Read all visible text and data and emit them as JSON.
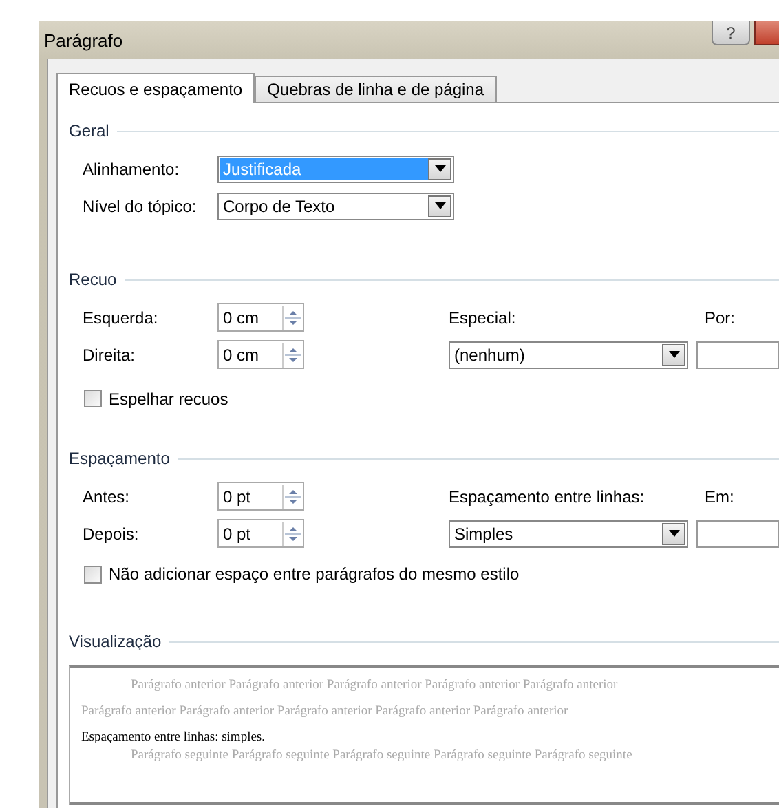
{
  "window": {
    "title": "Parágrafo",
    "help_button": "?"
  },
  "tabs": [
    {
      "label": "Recuos e espaçamento",
      "selected": true
    },
    {
      "label": "Quebras de linha e de página",
      "selected": false
    }
  ],
  "general": {
    "heading": "Geral",
    "fields": [
      {
        "label": "Alinhamento:",
        "value": "Justificada",
        "focused": true
      },
      {
        "label": "Nível do tópico:",
        "value": "Corpo de Texto",
        "focused": false
      }
    ]
  },
  "indent": {
    "heading": "Recuo",
    "spinners": [
      {
        "label": "Esquerda:",
        "value": "0 cm"
      },
      {
        "label": "Direita:",
        "value": "0 cm"
      }
    ],
    "special_label": "Especial:",
    "special_value": "(nenhum)",
    "by_label": "Por:",
    "checkbox": {
      "label": "Espelhar recuos",
      "checked": false
    }
  },
  "spacing": {
    "heading": "Espaçamento",
    "spinners": [
      {
        "label": "Antes:",
        "value": "0 pt"
      },
      {
        "label": "Depois:",
        "value": "0 pt"
      }
    ],
    "line_label": "Espaçamento entre linhas:",
    "line_value": "Simples",
    "at_label": "Em:",
    "checkbox": {
      "label": "Não adicionar espaço entre parágrafos do mesmo estilo",
      "checked": false
    }
  },
  "preview": {
    "heading": "Visualização",
    "before": [
      "Parágrafo anterior Parágrafo anterior Parágrafo anterior Parágrafo anterior Parágrafo anterior",
      "Parágrafo anterior Parágrafo anterior Parágrafo anterior Parágrafo anterior Parágrafo anterior"
    ],
    "current": "Espaçamento entre linhas: simples.",
    "after": [
      "Parágrafo seguinte Parágrafo seguinte Parágrafo seguinte Parágrafo seguinte Parágrafo seguinte"
    ]
  }
}
